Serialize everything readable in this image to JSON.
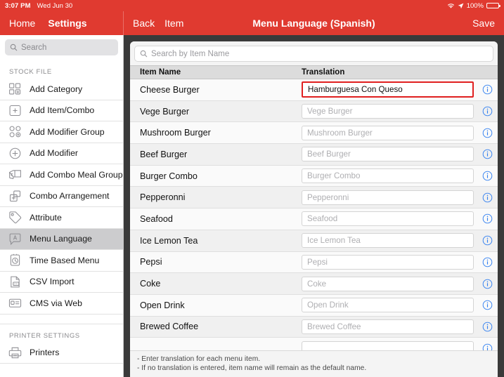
{
  "statusbar": {
    "time": "3:07 PM",
    "date": "Wed Jun 30",
    "battery_percent": "100%",
    "wifi_icon": "wifi-icon",
    "location_icon": "location-arrow-icon",
    "battery_icon": "battery-full-icon"
  },
  "navbar": {
    "home_label": "Home",
    "settings_label": "Settings",
    "back_label": "Back",
    "item_label": "Item",
    "title": "Menu Language (Spanish)",
    "save_label": "Save",
    "accent_color": "#E03A30"
  },
  "sidebar": {
    "search": {
      "placeholder": "Search",
      "value": "",
      "icon": "search-icon"
    },
    "sections": [
      {
        "title": "STOCK FILE",
        "items": [
          {
            "label": "Add Category",
            "icon": "grid-add-icon",
            "selected": false
          },
          {
            "label": "Add Item/Combo",
            "icon": "square-plus-icon",
            "selected": false
          },
          {
            "label": "Add Modifier Group",
            "icon": "circles-add-icon",
            "selected": false
          },
          {
            "label": "Add Modifier",
            "icon": "circle-plus-icon",
            "selected": false
          },
          {
            "label": "Add Combo Meal Group",
            "icon": "stacked-cards-icon",
            "selected": false
          },
          {
            "label": "Combo Arrangement",
            "icon": "overlap-squares-icon",
            "selected": false
          },
          {
            "label": "Attribute",
            "icon": "tag-icon",
            "selected": false
          },
          {
            "label": "Menu Language",
            "icon": "speech-bubble-a-icon",
            "selected": true
          },
          {
            "label": "Time Based Menu",
            "icon": "clock-doc-icon",
            "selected": false
          },
          {
            "label": "CSV Import",
            "icon": "csv-file-icon",
            "selected": false
          },
          {
            "label": "CMS via Web",
            "icon": "id-card-icon",
            "selected": false
          }
        ]
      },
      {
        "title": "PRINTER SETTINGS",
        "items": [
          {
            "label": "Printers",
            "icon": "printer-icon",
            "selected": false
          }
        ]
      }
    ]
  },
  "main": {
    "search": {
      "placeholder": "Search by Item Name",
      "value": "",
      "icon": "search-icon"
    },
    "columns": {
      "item_name": "Item Name",
      "translation": "Translation"
    },
    "info_icon": "info-circle-icon",
    "rows": [
      {
        "item_name": "Cheese Burger",
        "translation_value": "Hamburguesa Con Queso",
        "translation_placeholder": "Cheese Burger",
        "focused": true
      },
      {
        "item_name": "Vege Burger",
        "translation_value": "",
        "translation_placeholder": "Vege Burger",
        "focused": false
      },
      {
        "item_name": "Mushroom Burger",
        "translation_value": "",
        "translation_placeholder": "Mushroom Burger",
        "focused": false
      },
      {
        "item_name": "Beef Burger",
        "translation_value": "",
        "translation_placeholder": "Beef Burger",
        "focused": false
      },
      {
        "item_name": "Burger Combo",
        "translation_value": "",
        "translation_placeholder": "Burger Combo",
        "focused": false
      },
      {
        "item_name": "Pepperonni",
        "translation_value": "",
        "translation_placeholder": "Pepperonni",
        "focused": false
      },
      {
        "item_name": "Seafood",
        "translation_value": "",
        "translation_placeholder": "Seafood",
        "focused": false
      },
      {
        "item_name": "Ice Lemon Tea",
        "translation_value": "",
        "translation_placeholder": "Ice Lemon Tea",
        "focused": false
      },
      {
        "item_name": "Pepsi",
        "translation_value": "",
        "translation_placeholder": "Pepsi",
        "focused": false
      },
      {
        "item_name": "Coke",
        "translation_value": "",
        "translation_placeholder": "Coke",
        "focused": false
      },
      {
        "item_name": "Open Drink",
        "translation_value": "",
        "translation_placeholder": "Open Drink",
        "focused": false
      },
      {
        "item_name": "Brewed Coffee",
        "translation_value": "",
        "translation_placeholder": "Brewed Coffee",
        "focused": false
      },
      {
        "item_name": "",
        "translation_value": "",
        "translation_placeholder": "",
        "focused": false
      }
    ],
    "footnotes": [
      "- Enter translation for each menu item.",
      "- If no translation is entered, item name will remain as the default name."
    ]
  }
}
